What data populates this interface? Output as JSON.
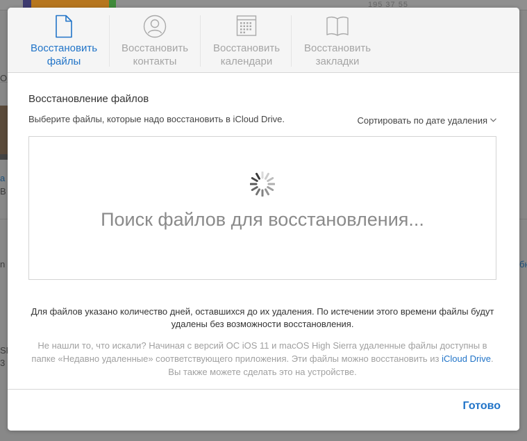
{
  "background": {
    "time_fragment": "195 37 55",
    "left_fragments": [
      "OS",
      "а",
      "B",
      "n",
      "SP",
      "3"
    ],
    "right_fragment": "бн"
  },
  "tabs": [
    {
      "label": "Восстановить\nфайлы",
      "icon": "document-icon",
      "active": true
    },
    {
      "label": "Восстановить\nконтакты",
      "icon": "contact-icon",
      "active": false
    },
    {
      "label": "Восстановить\nкалендари",
      "icon": "calendar-icon",
      "active": false
    },
    {
      "label": "Восстановить\nзакладки",
      "icon": "bookmarks-icon",
      "active": false
    }
  ],
  "main": {
    "title": "Восстановление файлов",
    "subtitle": "Выберите файлы, которые надо восстановить в iCloud Drive.",
    "sort_label": "Сортировать по дате удаления",
    "searching_text": "Поиск файлов для восстановления...",
    "note": "Для файлов указано количество дней, оставшихся до их удаления. По истечении этого времени файлы будут удалены без возможности восстановления.",
    "help_before": "Не нашли то, что искали? Начиная с версий ОС iOS 11 и macOS High Sierra удаленные файлы доступны в папке «Недавно удаленные» соответствующего приложения. Эти файлы можно восстановить из ",
    "help_link": "iCloud Drive",
    "help_after": ". Вы также можете сделать это на устройстве."
  },
  "footer": {
    "done_label": "Готово"
  },
  "colors": {
    "accent": "#2174c8",
    "inactive": "#a5a5a5"
  }
}
